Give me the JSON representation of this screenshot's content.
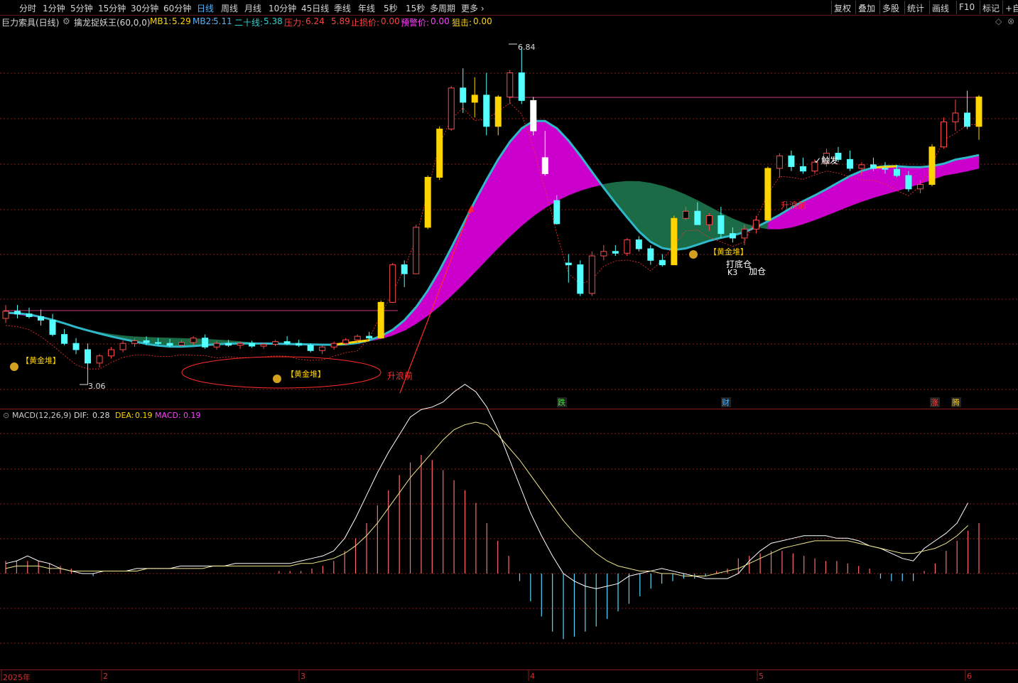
{
  "toolbar": {
    "periods": [
      "分时",
      "1分钟",
      "5分钟",
      "15分钟",
      "30分钟",
      "60分钟",
      "日线",
      "周线",
      "月线",
      "10分钟",
      "45日线",
      "季线",
      "年线",
      "5秒",
      "15秒",
      "多周期",
      "更多"
    ],
    "active": "日线",
    "more_arrow": "›",
    "right": [
      "复权",
      "叠加",
      "多股",
      "统计",
      "画线",
      "F10",
      "标记",
      "+自"
    ]
  },
  "info": {
    "stock": "巨力索具(日线)",
    "indicator": "擒龙捉妖王(60,0,0)",
    "mb1_label": "MB1:",
    "mb1": "5.29",
    "mb2_label": "MB2:",
    "mb2": "5.11",
    "ma20_label": "二十线:",
    "ma20": "5.38",
    "press_label": "压力:",
    "press": "6.24",
    "press2": "5.89",
    "stop_label": "止损价:",
    "stop": "0.00",
    "warn_label": "预警价:",
    "warn": "0.00",
    "snipe_label": "狙击:",
    "snipe": "0.00"
  },
  "macd": {
    "title": "MACD(12,26,9)",
    "dif_label": "DIF:",
    "dif": "0.28",
    "dea_label": "DEA:",
    "dea": "0.19",
    "macd_label": "MACD:",
    "macd": "0.19"
  },
  "annotations": {
    "high": "6.84",
    "low": "3.06",
    "golden_pile": "【黄金堆】",
    "rise_wave": "升浪前",
    "bottom_position": "打底仓",
    "k3": "K3",
    "add_position": "加仓",
    "trigger": "触发",
    "signal_die": "跌",
    "signal_cai": "财",
    "signal_zhang": "涨",
    "signal_teng": "腾"
  },
  "dates": [
    "2025年",
    "2",
    "3",
    "4",
    "5",
    "6"
  ],
  "colors": {
    "up": "#ff4a4a",
    "down": "#54ffff",
    "yellow": "#ffd400",
    "magenta": "#cc00cc",
    "green": "#1a6b46",
    "cyan": "#2fb8c8",
    "white_line": "#ffffff",
    "dea_line": "#f0e68c"
  },
  "chart_data": {
    "type": "candlestick",
    "high": 6.84,
    "low": 3.06,
    "candles": [
      [
        3.8,
        3.95,
        3.75,
        3.88
      ],
      [
        3.88,
        3.95,
        3.8,
        3.85
      ],
      [
        3.85,
        3.92,
        3.8,
        3.82
      ],
      [
        3.82,
        3.9,
        3.72,
        3.78
      ],
      [
        3.78,
        3.85,
        3.6,
        3.62
      ],
      [
        3.62,
        3.68,
        3.5,
        3.52
      ],
      [
        3.52,
        3.58,
        3.4,
        3.45
      ],
      [
        3.45,
        3.52,
        3.06,
        3.3
      ],
      [
        3.3,
        3.4,
        3.25,
        3.38
      ],
      [
        3.38,
        3.48,
        3.35,
        3.45
      ],
      [
        3.45,
        3.55,
        3.42,
        3.52
      ],
      [
        3.52,
        3.58,
        3.48,
        3.55
      ],
      [
        3.55,
        3.6,
        3.5,
        3.53
      ],
      [
        3.53,
        3.58,
        3.5,
        3.52
      ],
      [
        3.52,
        3.57,
        3.48,
        3.5
      ],
      [
        3.5,
        3.56,
        3.48,
        3.53
      ],
      [
        3.53,
        3.6,
        3.5,
        3.58
      ],
      [
        3.58,
        3.62,
        3.46,
        3.48
      ],
      [
        3.48,
        3.55,
        3.45,
        3.52
      ],
      [
        3.52,
        3.56,
        3.48,
        3.5
      ],
      [
        3.5,
        3.54,
        3.46,
        3.52
      ],
      [
        3.52,
        3.55,
        3.47,
        3.49
      ],
      [
        3.49,
        3.53,
        3.46,
        3.51
      ],
      [
        3.51,
        3.56,
        3.49,
        3.54
      ],
      [
        3.54,
        3.6,
        3.5,
        3.52
      ],
      [
        3.52,
        3.56,
        3.48,
        3.5
      ],
      [
        3.5,
        3.52,
        3.42,
        3.44
      ],
      [
        3.44,
        3.5,
        3.4,
        3.48
      ],
      [
        3.48,
        3.54,
        3.45,
        3.52
      ],
      [
        3.52,
        3.58,
        3.5,
        3.56
      ],
      [
        3.56,
        3.62,
        3.52,
        3.6
      ],
      [
        3.6,
        3.65,
        3.55,
        3.58
      ],
      [
        3.58,
        4.0,
        3.58,
        3.98
      ],
      [
        3.98,
        4.42,
        3.98,
        4.4
      ],
      [
        4.4,
        4.45,
        4.15,
        4.3
      ],
      [
        4.3,
        4.85,
        4.3,
        4.82
      ],
      [
        4.82,
        5.4,
        4.8,
        5.38
      ],
      [
        5.38,
        5.95,
        5.35,
        5.92
      ],
      [
        5.92,
        6.4,
        5.9,
        6.38
      ],
      [
        6.38,
        6.6,
        6.1,
        6.22
      ],
      [
        6.22,
        6.5,
        6.05,
        6.3
      ],
      [
        6.3,
        6.55,
        5.85,
        5.95
      ],
      [
        5.95,
        6.3,
        5.85,
        6.28
      ],
      [
        6.28,
        6.58,
        6.2,
        6.55
      ],
      [
        6.55,
        6.84,
        6.2,
        6.24
      ],
      [
        6.24,
        6.28,
        5.85,
        5.9
      ],
      [
        5.6,
        5.9,
        5.4,
        5.42
      ],
      [
        5.12,
        5.18,
        4.85,
        4.86
      ],
      [
        4.42,
        4.52,
        4.2,
        4.4
      ],
      [
        4.4,
        4.45,
        4.05,
        4.08
      ],
      [
        4.08,
        4.55,
        4.05,
        4.5
      ],
      [
        4.5,
        4.62,
        4.45,
        4.55
      ],
      [
        4.55,
        4.62,
        4.5,
        4.53
      ],
      [
        4.53,
        4.7,
        4.5,
        4.68
      ],
      [
        4.68,
        4.72,
        4.55,
        4.58
      ],
      [
        4.58,
        4.62,
        4.4,
        4.45
      ],
      [
        4.45,
        4.52,
        4.38,
        4.4
      ],
      [
        4.4,
        4.95,
        4.4,
        4.92
      ],
      [
        4.92,
        5.05,
        4.9,
        5.0
      ],
      [
        5.0,
        5.1,
        4.85,
        4.85
      ],
      [
        4.85,
        4.98,
        4.78,
        4.95
      ],
      [
        4.95,
        5.05,
        4.7,
        4.75
      ],
      [
        4.75,
        4.82,
        4.65,
        4.7
      ],
      [
        4.7,
        4.85,
        4.62,
        4.8
      ],
      [
        4.8,
        4.95,
        4.75,
        4.9
      ],
      [
        4.9,
        5.5,
        4.9,
        5.48
      ],
      [
        5.48,
        5.65,
        5.38,
        5.62
      ],
      [
        5.62,
        5.68,
        5.45,
        5.5
      ],
      [
        5.5,
        5.6,
        5.42,
        5.45
      ],
      [
        5.45,
        5.58,
        5.42,
        5.55
      ],
      [
        5.55,
        5.7,
        5.5,
        5.65
      ],
      [
        5.65,
        5.72,
        5.55,
        5.58
      ],
      [
        5.58,
        5.68,
        5.45,
        5.48
      ],
      [
        5.48,
        5.55,
        5.4,
        5.52
      ],
      [
        5.52,
        5.6,
        5.45,
        5.48
      ],
      [
        5.48,
        5.55,
        5.42,
        5.47
      ],
      [
        5.47,
        5.52,
        5.38,
        5.4
      ],
      [
        5.4,
        5.45,
        5.22,
        5.25
      ],
      [
        5.25,
        5.35,
        5.2,
        5.3
      ],
      [
        5.3,
        5.75,
        5.28,
        5.72
      ],
      [
        5.72,
        6.05,
        5.7,
        6.0
      ],
      [
        6.0,
        6.25,
        5.9,
        6.1
      ],
      [
        6.1,
        6.35,
        5.92,
        5.95
      ],
      [
        5.95,
        6.3,
        5.8,
        6.28
      ]
    ],
    "macd_hist": [
      0.05,
      0.05,
      0.05,
      0.05,
      0.04,
      0.03,
      0.02,
      0.0,
      -0.01,
      0.0,
      0.0,
      0.0,
      0.0,
      0.0,
      0.0,
      0.0,
      0.0,
      0.0,
      0.0,
      0.0,
      0.0,
      0.0,
      0.0,
      0.0,
      0.0,
      0.01,
      0.01,
      0.01,
      0.02,
      0.03,
      0.05,
      0.09,
      0.14,
      0.2,
      0.27,
      0.33,
      0.39,
      0.44,
      0.47,
      0.45,
      0.41,
      0.37,
      0.33,
      0.28,
      0.2,
      0.13,
      0.07,
      -0.03,
      -0.11,
      -0.17,
      -0.23,
      -0.26,
      -0.25,
      -0.23,
      -0.21,
      -0.18,
      -0.15,
      -0.12,
      -0.09,
      -0.06,
      -0.04,
      -0.03,
      -0.02,
      -0.02,
      -0.01,
      0.01,
      0.02,
      0.06,
      0.07,
      0.08,
      0.09,
      0.09,
      0.08,
      0.07,
      0.06,
      0.05,
      0.05,
      0.04,
      0.03,
      0.02,
      -0.02,
      -0.03,
      -0.03,
      -0.03,
      0.01,
      0.04,
      0.09,
      0.13,
      0.17,
      0.2
    ],
    "dif": [
      0.04,
      0.05,
      0.07,
      0.05,
      0.04,
      0.02,
      0.01,
      0.0,
      0.0,
      0.01,
      0.01,
      0.01,
      0.02,
      0.02,
      0.02,
      0.02,
      0.03,
      0.03,
      0.03,
      0.03,
      0.03,
      0.04,
      0.04,
      0.04,
      0.04,
      0.04,
      0.04,
      0.05,
      0.06,
      0.07,
      0.09,
      0.14,
      0.22,
      0.31,
      0.4,
      0.48,
      0.55,
      0.62,
      0.65,
      0.66,
      0.68,
      0.72,
      0.75,
      0.72,
      0.66,
      0.57,
      0.46,
      0.35,
      0.24,
      0.15,
      0.07,
      0.0,
      -0.03,
      -0.05,
      -0.06,
      -0.05,
      -0.04,
      -0.01,
      0.0,
      0.01,
      0.02,
      0.01,
      0.0,
      -0.01,
      -0.02,
      -0.02,
      -0.02,
      0.0,
      0.05,
      0.09,
      0.12,
      0.13,
      0.14,
      0.15,
      0.15,
      0.15,
      0.14,
      0.14,
      0.13,
      0.11,
      0.1,
      0.08,
      0.06,
      0.05,
      0.1,
      0.13,
      0.16,
      0.2,
      0.28
    ],
    "dea": [
      0.02,
      0.03,
      0.03,
      0.03,
      0.02,
      0.02,
      0.01,
      0.01,
      0.01,
      0.01,
      0.01,
      0.01,
      0.01,
      0.02,
      0.02,
      0.02,
      0.02,
      0.02,
      0.02,
      0.03,
      0.03,
      0.03,
      0.03,
      0.03,
      0.03,
      0.03,
      0.03,
      0.04,
      0.04,
      0.05,
      0.06,
      0.08,
      0.11,
      0.15,
      0.2,
      0.26,
      0.32,
      0.38,
      0.43,
      0.48,
      0.53,
      0.57,
      0.59,
      0.6,
      0.59,
      0.55,
      0.5,
      0.45,
      0.39,
      0.33,
      0.27,
      0.21,
      0.16,
      0.12,
      0.08,
      0.05,
      0.03,
      0.02,
      0.01,
      0.01,
      0.0,
      0.0,
      -0.01,
      -0.01,
      -0.01,
      0.0,
      0.01,
      0.02,
      0.04,
      0.06,
      0.08,
      0.1,
      0.11,
      0.12,
      0.13,
      0.13,
      0.13,
      0.13,
      0.12,
      0.11,
      0.1,
      0.09,
      0.08,
      0.08,
      0.09,
      0.1,
      0.12,
      0.15,
      0.19
    ]
  }
}
